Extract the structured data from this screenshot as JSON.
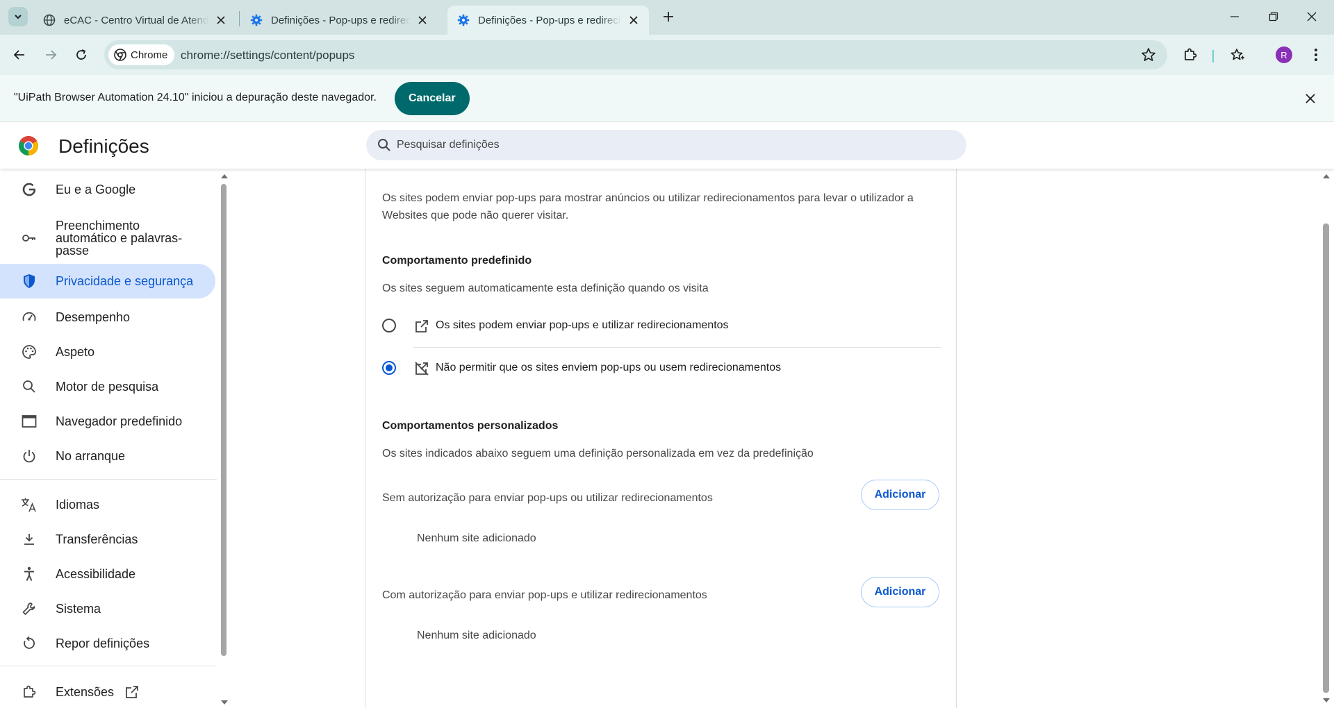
{
  "tabs": [
    {
      "title": "eCAC - Centro Virtual de Atendimento",
      "active": false
    },
    {
      "title": "Definições - Pop-ups e redirecionamentos",
      "active": false
    },
    {
      "title": "Definições - Pop-ups e redirecionamentos",
      "active": true
    }
  ],
  "toolbar": {
    "chip_label": "Chrome",
    "url": "chrome://settings/content/popups",
    "avatar_letter": "R"
  },
  "infobar": {
    "message": "\"UiPath Browser Automation 24.10\" iniciou a depuração deste navegador.",
    "cancel_label": "Cancelar"
  },
  "header": {
    "title": "Definições",
    "search_placeholder": "Pesquisar definições"
  },
  "sidebar": {
    "items": [
      {
        "label": "Eu e a Google",
        "icon": "google-g-icon"
      },
      {
        "label": "Preenchimento automático e palavras-passe",
        "icon": "key-icon"
      },
      {
        "label": "Privacidade e segurança",
        "icon": "shield-icon",
        "active": true
      },
      {
        "label": "Desempenho",
        "icon": "speedometer-icon"
      },
      {
        "label": "Aspeto",
        "icon": "palette-icon"
      },
      {
        "label": "Motor de pesquisa",
        "icon": "search-icon"
      },
      {
        "label": "Navegador predefinido",
        "icon": "browser-window-icon"
      },
      {
        "label": "No arranque",
        "icon": "power-icon"
      },
      {
        "label": "Idiomas",
        "icon": "translate-icon"
      },
      {
        "label": "Transferências",
        "icon": "download-icon"
      },
      {
        "label": "Acessibilidade",
        "icon": "accessibility-icon"
      },
      {
        "label": "Sistema",
        "icon": "wrench-icon"
      },
      {
        "label": "Repor definições",
        "icon": "reset-icon"
      },
      {
        "label": "Extensões",
        "icon": "puzzle-icon"
      }
    ]
  },
  "main": {
    "description": "Os sites podem enviar pop-ups para mostrar anúncios ou utilizar redirecionamentos para levar o utilizador a Websites que pode não querer visitar.",
    "default_behavior": {
      "title": "Comportamento predefinido",
      "subtitle": "Os sites seguem automaticamente esta definição quando os visita",
      "options": [
        {
          "label": "Os sites podem enviar pop-ups e utilizar redirecionamentos",
          "checked": false
        },
        {
          "label": "Não permitir que os sites enviem pop-ups ou usem redirecionamentos",
          "checked": true
        }
      ]
    },
    "custom_behaviors": {
      "title": "Comportamentos personalizados",
      "subtitle": "Os sites indicados abaixo seguem uma definição personalizada em vez da predefinição",
      "blocked": {
        "label": "Sem autorização para enviar pop-ups ou utilizar redirecionamentos",
        "add_label": "Adicionar",
        "empty": "Nenhum site adicionado"
      },
      "allowed": {
        "label": "Com autorização para enviar pop-ups e utilizar redirecionamentos",
        "add_label": "Adicionar",
        "empty": "Nenhum site adicionado"
      }
    }
  },
  "colors": {
    "accent": "#0b57d0",
    "active_nav_bg": "#d3e3fd",
    "cancel_button": "#00696b",
    "tabstrip": "#d3e3e3"
  }
}
